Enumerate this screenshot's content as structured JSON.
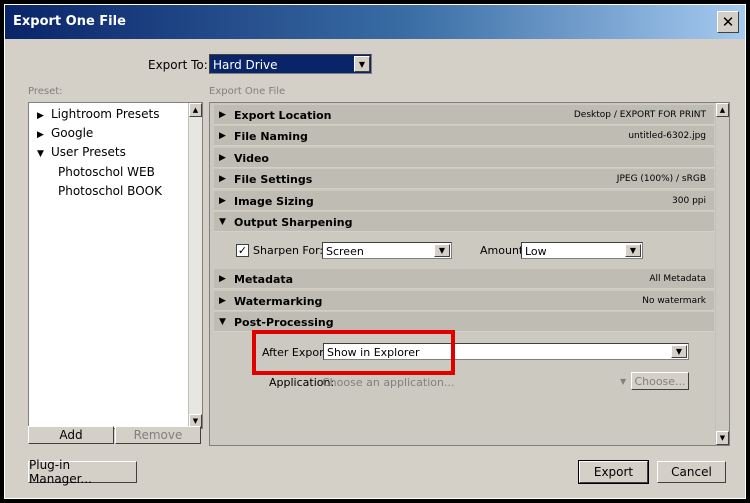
{
  "window": {
    "title": "Export One File"
  },
  "export_to": {
    "label": "Export To:",
    "value": "Hard Drive"
  },
  "preset": {
    "label": "Preset:",
    "items": [
      {
        "label": "Lightroom Presets",
        "expander": "▶"
      },
      {
        "label": "Google",
        "expander": "▶"
      },
      {
        "label": "User Presets",
        "expander": "▼"
      },
      {
        "label": "Photoschol WEB",
        "expander": ""
      },
      {
        "label": "Photoschol BOOK",
        "expander": ""
      }
    ],
    "add_label": "Add",
    "remove_label": "Remove"
  },
  "main": {
    "label": "Export One File",
    "sections": {
      "export_location": {
        "name": "Export Location",
        "value": "Desktop / EXPORT FOR PRINT",
        "expander": "▶"
      },
      "file_naming": {
        "name": "File Naming",
        "value": "untitled-6302.jpg",
        "expander": "▶"
      },
      "video": {
        "name": "Video",
        "value": "",
        "expander": "▶"
      },
      "file_settings": {
        "name": "File Settings",
        "value": "JPEG (100%) / sRGB",
        "expander": "▶"
      },
      "image_sizing": {
        "name": "Image Sizing",
        "value": "300 ppi",
        "expander": "▶"
      },
      "output_sharpening": {
        "name": "Output Sharpening",
        "value": "",
        "expander": "▼"
      },
      "metadata": {
        "name": "Metadata",
        "value": "All Metadata",
        "expander": "▶"
      },
      "watermarking": {
        "name": "Watermarking",
        "value": "No watermark",
        "expander": "▶"
      },
      "post_processing": {
        "name": "Post-Processing",
        "value": "",
        "expander": "▼"
      }
    },
    "sharpen": {
      "check": "✓",
      "label": "Sharpen For:",
      "value": "Screen",
      "amount_label": "Amount:",
      "amount_value": "Low"
    },
    "post": {
      "after_export_label": "After Export:",
      "after_export_value": "Show in Explorer",
      "application_label": "Application:",
      "application_placeholder": "Choose an application...",
      "choose_label": "Choose..."
    }
  },
  "footer": {
    "plugin_label": "Plug-in Manager...",
    "export_label": "Export",
    "cancel_label": "Cancel"
  },
  "icons": {
    "dropdown": "▼",
    "scroll_up": "▲",
    "scroll_down": "▼",
    "close": "✕"
  }
}
